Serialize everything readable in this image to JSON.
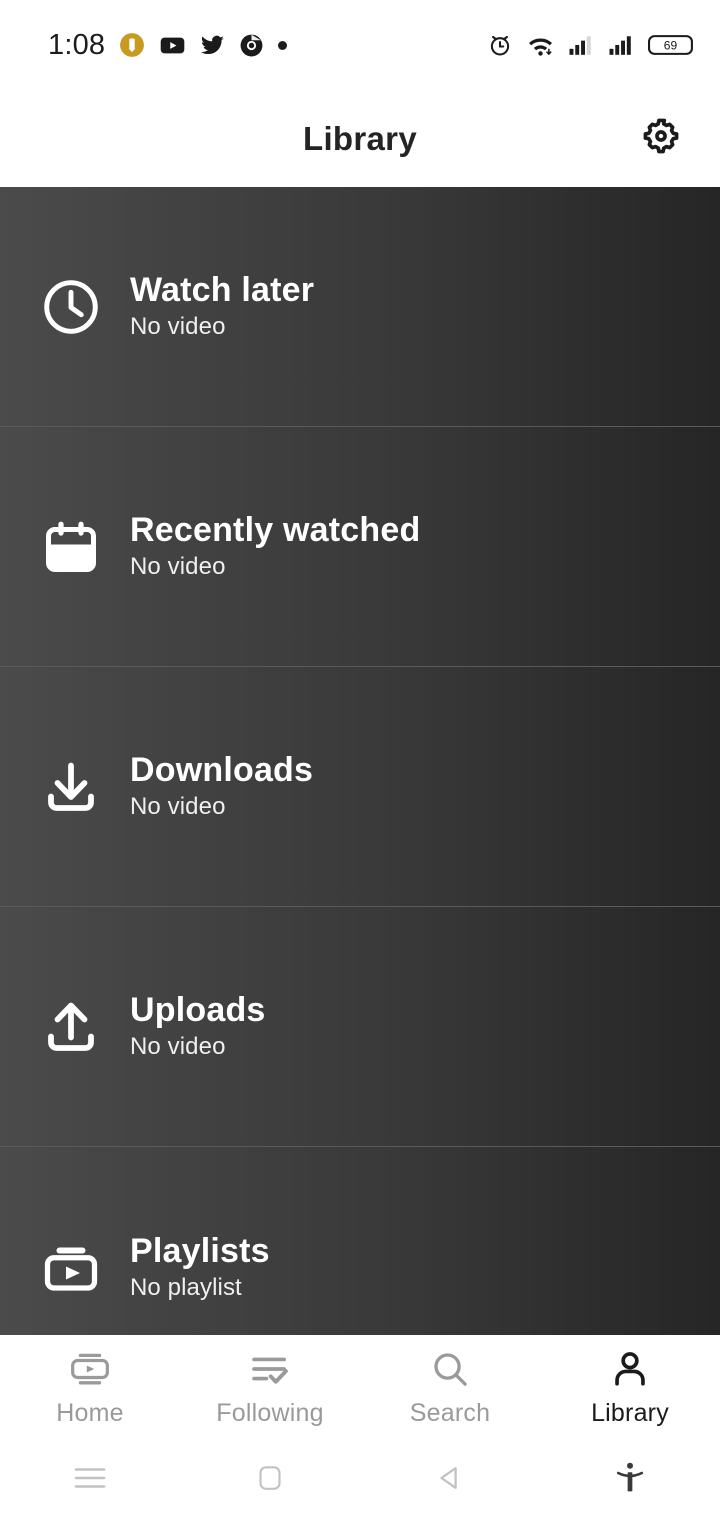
{
  "status_bar": {
    "time": "1:08",
    "left_icons": [
      "download-notification-icon",
      "youtube-icon",
      "twitter-icon",
      "chrome-icon",
      "more-dot-icon"
    ],
    "right_icons": [
      "alarm-icon",
      "wifi-icon",
      "signal-1-icon",
      "signal-2-icon"
    ],
    "battery_level": "69",
    "accent_download": "#c79a22"
  },
  "header": {
    "title": "Library",
    "settings_icon": "gear-icon"
  },
  "library": {
    "items": [
      {
        "icon": "clock-icon",
        "title": "Watch later",
        "subtitle": "No video"
      },
      {
        "icon": "calendar-icon",
        "title": "Recently watched",
        "subtitle": "No video"
      },
      {
        "icon": "download-icon",
        "title": "Downloads",
        "subtitle": "No video"
      },
      {
        "icon": "upload-icon",
        "title": "Uploads",
        "subtitle": "No video"
      },
      {
        "icon": "playlist-icon",
        "title": "Playlists",
        "subtitle": "No playlist"
      }
    ],
    "colors": {
      "bg_left": "#4b4b4b",
      "bg_right": "#262626",
      "divider": "#5a5a5a",
      "title_text": "#ffffff",
      "subtitle_text": "#efefef"
    }
  },
  "tab_bar": {
    "tabs": [
      {
        "label": "Home",
        "icon": "video-home-icon",
        "active": false
      },
      {
        "label": "Following",
        "icon": "list-check-icon",
        "active": false
      },
      {
        "label": "Search",
        "icon": "search-icon",
        "active": false
      },
      {
        "label": "Library",
        "icon": "person-icon",
        "active": true
      }
    ],
    "active_color": "#1b1b1b",
    "inactive_color": "#9a9a9a"
  },
  "system_nav": {
    "buttons": [
      "recents-menu-icon",
      "home-square-icon",
      "back-triangle-icon",
      "accessibility-icon"
    ]
  }
}
